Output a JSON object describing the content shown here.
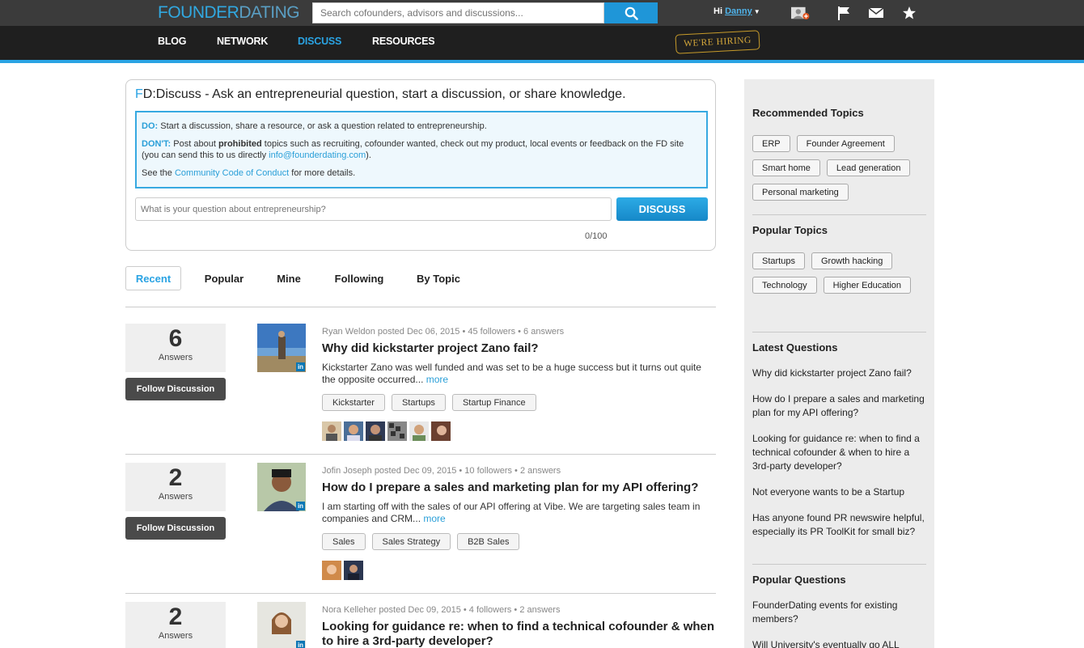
{
  "header": {
    "logo_bold": "FOUNDER",
    "logo_light": "DATING",
    "search_placeholder": "Search cofounders, advisors and discussions...",
    "greeting": "Hi",
    "user_name": "Danny",
    "icons": [
      "user-add-icon",
      "flag-icon",
      "mail-icon",
      "star-icon"
    ]
  },
  "nav": {
    "items": [
      "BLOG",
      "NETWORK",
      "DISCUSS",
      "RESOURCES"
    ],
    "active": "DISCUSS",
    "hiring": "WE'RE HIRING"
  },
  "ask": {
    "title_f": "F",
    "title_rest": "D:Discuss - Ask an entrepreneurial question, start a discussion, or share knowledge.",
    "do_label": "DO:",
    "do_text": " Start a discussion, share a resource, or ask a question related to entrepreneurship.",
    "dont_label": "DON'T:",
    "dont_text1": " Post about ",
    "dont_bold": "prohibited",
    "dont_text2": " topics such as recruiting, cofounder wanted, check out my product, local events or feedback on the FD site (you can send this to us directly ",
    "dont_email": "info@founderdating.com",
    "dont_text3": ").",
    "see_text1": "See the ",
    "see_link": "Community Code of Conduct",
    "see_text2": " for more details.",
    "input_placeholder": "What is your question about entrepreneurship?",
    "button_label": "DISCUSS",
    "counter": "0/100"
  },
  "tabs": [
    "Recent",
    "Popular",
    "Mine",
    "Following",
    "By Topic"
  ],
  "discussions": [
    {
      "answers": "6",
      "answers_label": "Answers",
      "follow_label": "Follow Discussion",
      "meta": "Ryan Weldon posted Dec 06, 2015 • 45 followers • 6 answers",
      "title": "Why did kickstarter project Zano fail?",
      "excerpt": "Kickstarter Zano was well funded and was set to be a huge success but it turns out quite the opposite occurred... ",
      "more": "more",
      "tags": [
        "Kickstarter",
        "Startups",
        "Startup Finance"
      ]
    },
    {
      "answers": "2",
      "answers_label": "Answers",
      "follow_label": "Follow Discussion",
      "meta": "Jofin Joseph posted Dec 09, 2015 • 10 followers • 2 answers",
      "title": "How do I prepare a sales and marketing plan for my API offering?",
      "excerpt": "I am starting off with the sales of our API offering at Vibe. We are targeting sales team in companies and CRM... ",
      "more": "more",
      "tags": [
        "Sales",
        "Sales Strategy",
        "B2B Sales"
      ]
    },
    {
      "answers": "2",
      "answers_label": "Answers",
      "meta": "Nora Kelleher posted Dec 09, 2015 • 4 followers • 2 answers",
      "title": "Looking for guidance re: when to find a technical cofounder & when to hire a 3rd-party developer?"
    }
  ],
  "linkedin_badge": "in",
  "sidebar": {
    "recommended_title": "Recommended Topics",
    "recommended": [
      "ERP",
      "Founder Agreement",
      "Smart home",
      "Lead generation",
      "Personal marketing"
    ],
    "popular_title": "Popular Topics",
    "popular": [
      "Startups",
      "Growth hacking",
      "Technology",
      "Higher Education"
    ],
    "latest_title": "Latest Questions",
    "latest": [
      "Why did kickstarter project Zano fail?",
      "How do I prepare a sales and marketing plan for my API offering?",
      "Looking for guidance re: when to find a technical cofounder & when to hire a 3rd-party developer?",
      "Not everyone wants to be a Startup",
      "Has anyone found PR newswire helpful, especially its PR ToolKit for small biz?"
    ],
    "popular_q_title": "Popular Questions",
    "popular_q": [
      "FounderDating events for existing members?",
      "Will University's eventually go ALL"
    ]
  },
  "colors": {
    "accent": "#2aa3e3",
    "topbar": "#3b3b3b",
    "navbar": "#1f1f1f"
  }
}
